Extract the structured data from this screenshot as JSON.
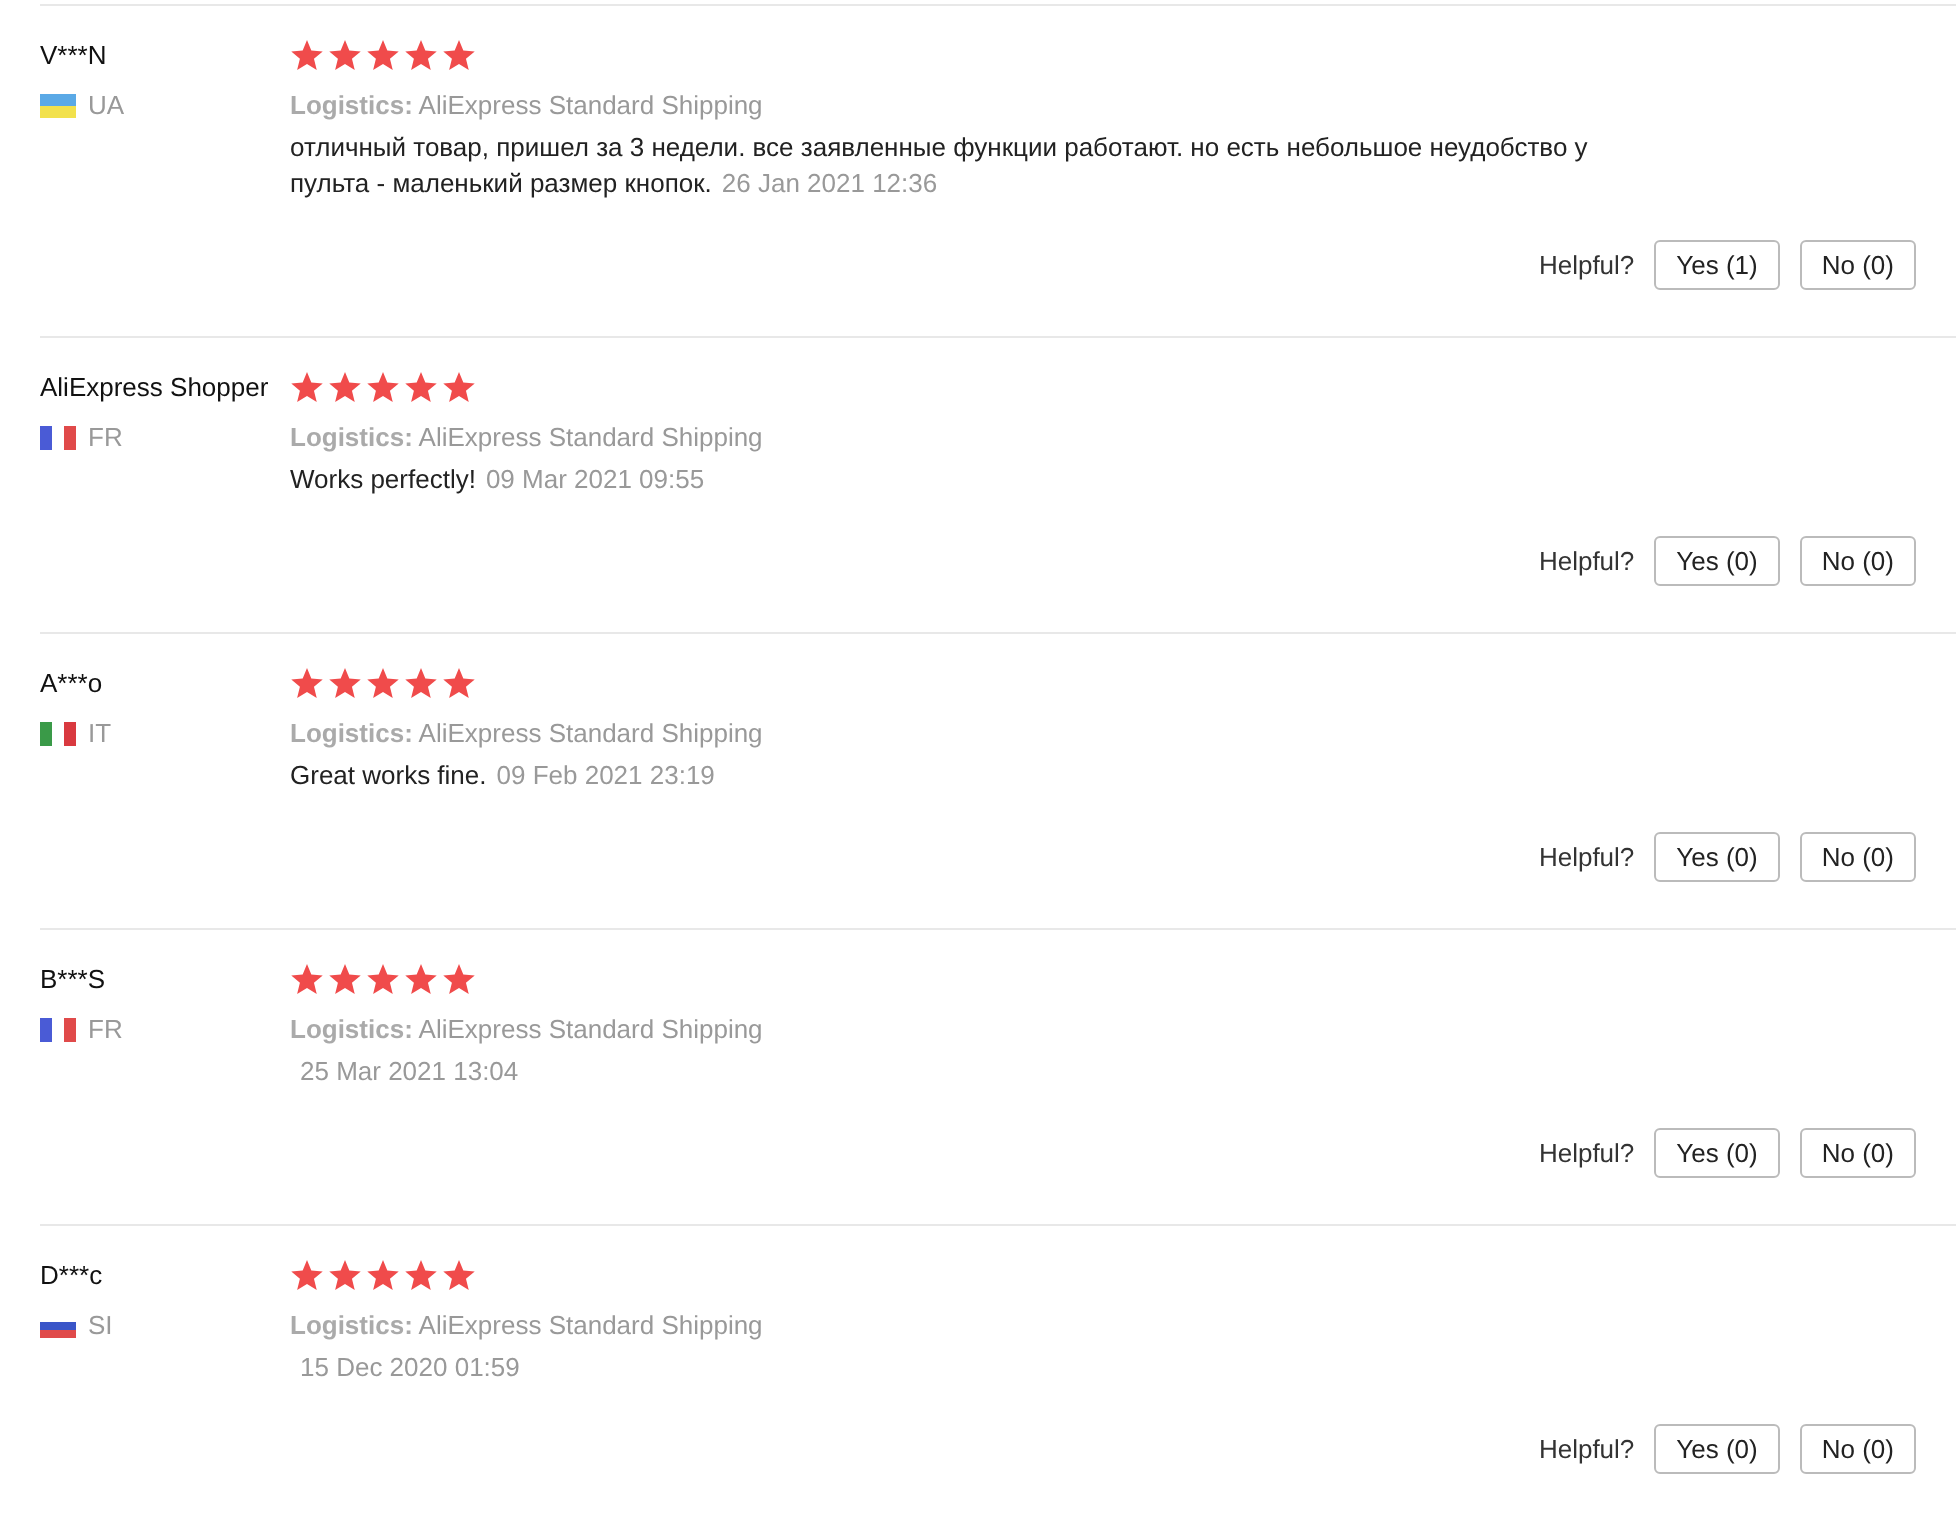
{
  "reviews": [
    {
      "name": "V***N",
      "country": "UA",
      "flag": {
        "kind": "horizontal",
        "stripes": [
          {
            "color": "#5aa9e6"
          },
          {
            "color": "#f2e14c"
          }
        ]
      },
      "stars": 5,
      "logistics": "**Logistics:** AliExpress Standard Shipping",
      "comment": "отличный товар, пришел за 3 недели. все заявленные функции работают. но есть небольшое неудобство у пульта - маленький размер кнопок.",
      "date": "26 Jan 2021 12:36",
      "helpful_label": "Helpful?",
      "yes": "Yes (1)",
      "no": "No (0)"
    },
    {
      "name": "AliExpress Shopper",
      "country": "FR",
      "flag": {
        "kind": "vertical",
        "stripes": [
          {
            "color": "#4a5bd6"
          },
          {
            "color": "#ffffff"
          },
          {
            "color": "#e04a4a"
          }
        ]
      },
      "stars": 5,
      "logistics": "**Logistics:** AliExpress Standard Shipping",
      "comment": "Works perfectly!",
      "date": "09 Mar 2021 09:55",
      "helpful_label": "Helpful?",
      "yes": "Yes (0)",
      "no": "No (0)"
    },
    {
      "name": "A***o",
      "country": "IT",
      "flag": {
        "kind": "vertical",
        "stripes": [
          {
            "color": "#3a9a48"
          },
          {
            "color": "#ffffff"
          },
          {
            "color": "#d9393f"
          }
        ]
      },
      "stars": 5,
      "logistics": "**Logistics:** AliExpress Standard Shipping",
      "comment": "Great works fine.",
      "date": "09 Feb 2021 23:19",
      "helpful_label": "Helpful?",
      "yes": "Yes (0)",
      "no": "No (0)"
    },
    {
      "name": "B***S",
      "country": "FR",
      "flag": {
        "kind": "vertical",
        "stripes": [
          {
            "color": "#4a5bd6"
          },
          {
            "color": "#ffffff"
          },
          {
            "color": "#e04a4a"
          }
        ]
      },
      "stars": 5,
      "logistics": "**Logistics:** AliExpress Standard Shipping",
      "date": "25 Mar 2021 13:04",
      "helpful_label": "Helpful?",
      "yes": "Yes (0)",
      "no": "No (0)"
    },
    {
      "name": "D***c",
      "country": "SI",
      "flag": {
        "kind": "horizontal",
        "stripes": [
          {
            "color": "#ffffff"
          },
          {
            "color": "#3a55c8"
          },
          {
            "color": "#e04a4a"
          }
        ]
      },
      "stars": 5,
      "logistics": "**Logistics:** AliExpress Standard Shipping",
      "date": "15 Dec 2020 01:59",
      "helpful_label": "Helpful?",
      "yes": "Yes (0)",
      "no": "No (0)"
    }
  ]
}
